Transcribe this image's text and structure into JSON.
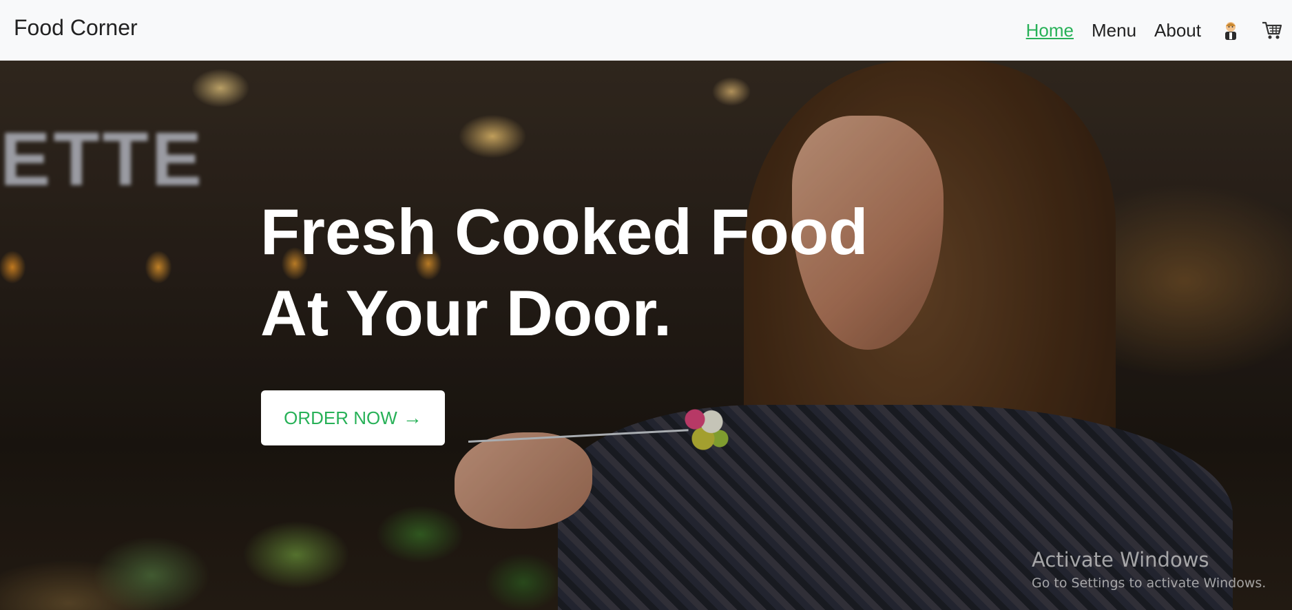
{
  "navbar": {
    "brand": "Food Corner",
    "links": [
      {
        "label": "Home",
        "active": true
      },
      {
        "label": "Menu",
        "active": false
      },
      {
        "label": "About",
        "active": false
      }
    ],
    "icons": [
      "user-chef-icon",
      "shopping-cart-icon"
    ],
    "active_color": "#28b158"
  },
  "hero": {
    "title_line1": "Fresh Cooked Food",
    "title_line2": "At Your Door.",
    "cta_label": "ORDER NOW",
    "cta_arrow": "→",
    "background_sign": "ETTE"
  },
  "watermark": {
    "title": "Activate Windows",
    "subtitle": "Go to Settings to activate Windows."
  }
}
